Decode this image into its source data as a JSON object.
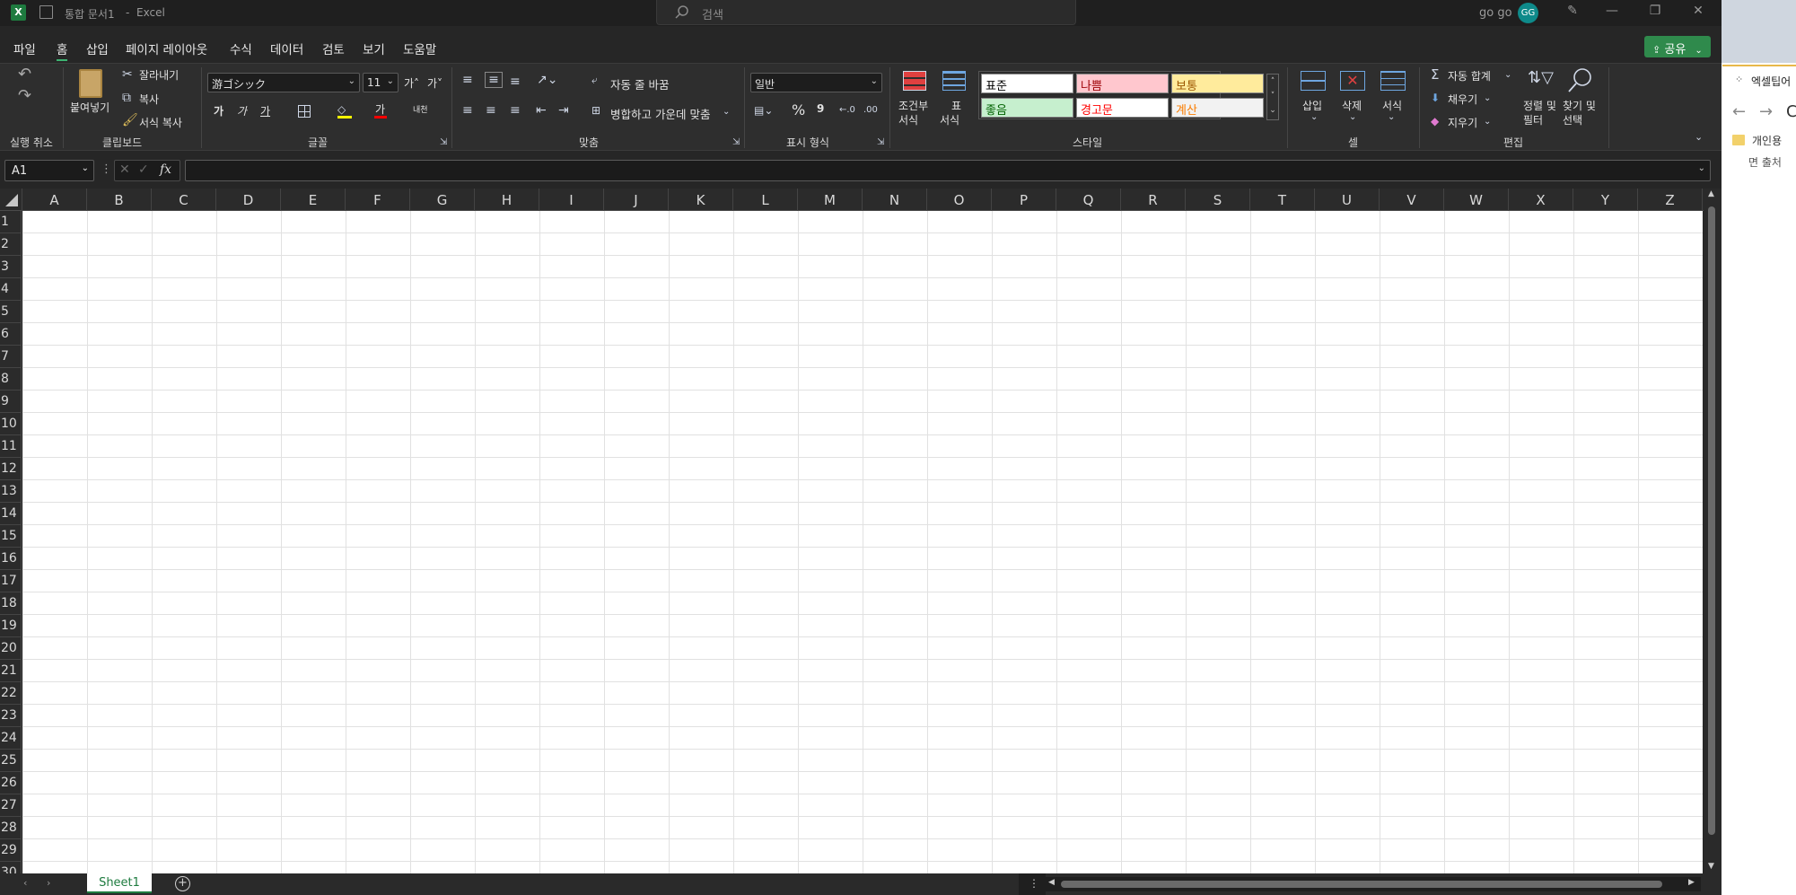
{
  "titlebar": {
    "save_icon": "save-icon",
    "doc_title": "통합 문서1",
    "separator": "-",
    "app_name": "Excel",
    "search_placeholder": "검색",
    "user_name": "go go",
    "avatar_initials": "GG"
  },
  "menu": {
    "items": [
      "파일",
      "홈",
      "삽입",
      "페이지 레이아웃",
      "수식",
      "데이터",
      "검토",
      "보기",
      "도움말"
    ],
    "active": "홈",
    "share_label": "공유"
  },
  "ribbon": {
    "undo": {
      "label": "실행 취소"
    },
    "clipboard": {
      "label": "클립보드",
      "paste": "붙여넣기",
      "cut": "잘라내기",
      "copy": "복사",
      "format_painter": "서식 복사"
    },
    "font": {
      "label": "글꼴",
      "font_name": "游ゴシック",
      "font_size": "11",
      "grow": "가˄",
      "shrink": "가˅",
      "bold": "가",
      "italic": "가",
      "underline": "가",
      "color_glyph": "가",
      "phonetic": "내천"
    },
    "alignment": {
      "label": "맞춤",
      "wrap_text": "자동 줄 바꿈",
      "merge_center": "병합하고 가운데 맞춤"
    },
    "number": {
      "label": "표시 형식",
      "format": "일반",
      "percent": "%",
      "comma": "9"
    },
    "styles": {
      "label": "스타일",
      "conditional": [
        "조건부",
        "서식"
      ],
      "format_as_table": [
        "표",
        "서식"
      ],
      "cells": [
        {
          "text": "표준",
          "bg": "#ffffff",
          "fg": "#000000"
        },
        {
          "text": "나쁨",
          "bg": "#ffc7ce",
          "fg": "#9c0006"
        },
        {
          "text": "보통",
          "bg": "#ffeb9c",
          "fg": "#9c5700"
        },
        {
          "text": "좋음",
          "bg": "#c6efce",
          "fg": "#006100"
        },
        {
          "text": "경고문",
          "bg": "#ffffff",
          "fg": "#ff0000"
        },
        {
          "text": "계산",
          "bg": "#f2f2f2",
          "fg": "#fa7d00"
        }
      ]
    },
    "cells": {
      "label": "셀",
      "insert": "삽입",
      "delete": "삭제",
      "format": "서식"
    },
    "editing": {
      "label": "편집",
      "autosum": "자동 합계",
      "fill": "채우기",
      "clear": "지우기",
      "sort_filter": [
        "정렬 및",
        "필터"
      ],
      "find_select": [
        "찾기 및",
        "선택"
      ]
    }
  },
  "formula_bar": {
    "name_box": "A1",
    "fx": "fx",
    "value": ""
  },
  "grid": {
    "columns": [
      "A",
      "B",
      "C",
      "D",
      "E",
      "F",
      "G",
      "H",
      "I",
      "J",
      "K",
      "L",
      "M",
      "N",
      "O",
      "P",
      "Q",
      "R",
      "S",
      "T",
      "U",
      "V",
      "W",
      "X",
      "Y",
      "Z"
    ],
    "rows": [
      "1",
      "2",
      "3",
      "4",
      "5",
      "6",
      "7",
      "8",
      "9",
      "10",
      "11",
      "12",
      "13",
      "14",
      "15",
      "16",
      "17",
      "18",
      "19",
      "20",
      "21",
      "22",
      "23",
      "24",
      "25",
      "26",
      "27",
      "28",
      "29",
      "30"
    ]
  },
  "sheets": {
    "tabs": [
      "Sheet1"
    ],
    "active": "Sheet1"
  },
  "right_pane": {
    "tab_title": "엑셀팁어",
    "folder_label": "개인용",
    "item_label": "면 출처"
  },
  "colors": {
    "accent_green": "#2f8a4c",
    "avatar_teal": "#0e8a8a"
  }
}
